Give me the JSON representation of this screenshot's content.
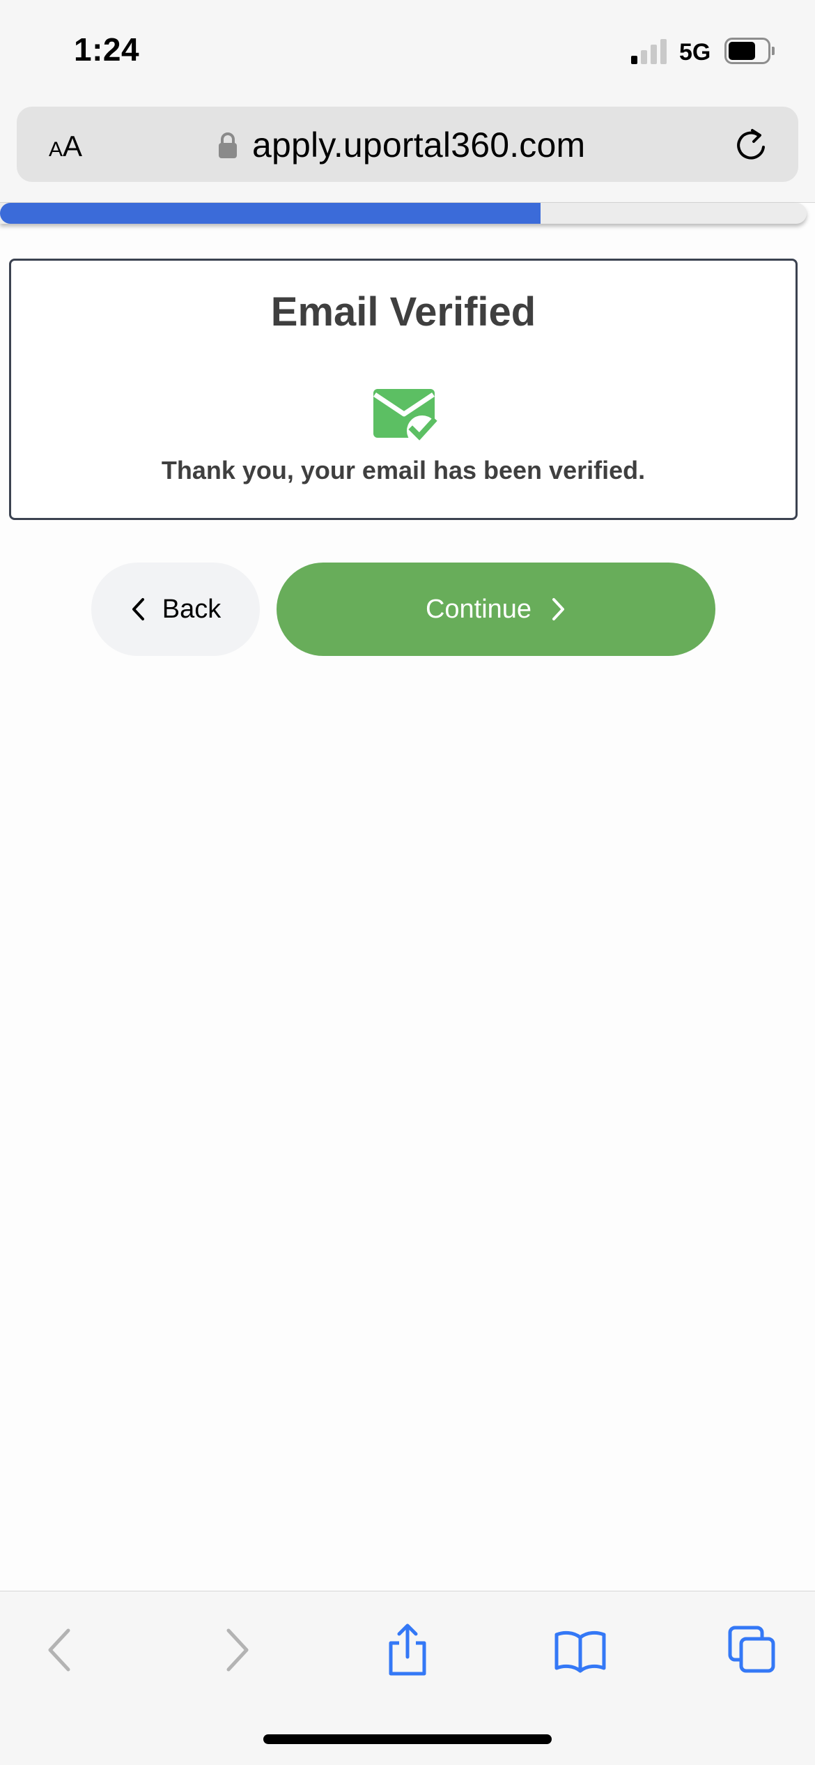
{
  "status_bar": {
    "time": "1:24",
    "network": "5G",
    "signal_bars_active": 1,
    "signal_bars_total": 4,
    "battery_level": 0.7
  },
  "browser": {
    "text_size_small": "A",
    "text_size_large": "A",
    "url": "apply.uportal360.com",
    "icons": {
      "lock": "lock-icon",
      "reload": "reload-icon",
      "back": "chevron-left-icon",
      "forward": "chevron-right-icon",
      "share": "share-icon",
      "bookmarks": "book-icon",
      "tabs": "tabs-icon"
    }
  },
  "progress": {
    "value": 0.67,
    "fill_color": "#3b6bd9"
  },
  "card": {
    "title": "Email Verified",
    "icon": "email-verified-icon",
    "message": "Thank you, your email has been verified."
  },
  "actions": {
    "back_label": "Back",
    "continue_label": "Continue",
    "continue_color": "#68ad5a"
  }
}
